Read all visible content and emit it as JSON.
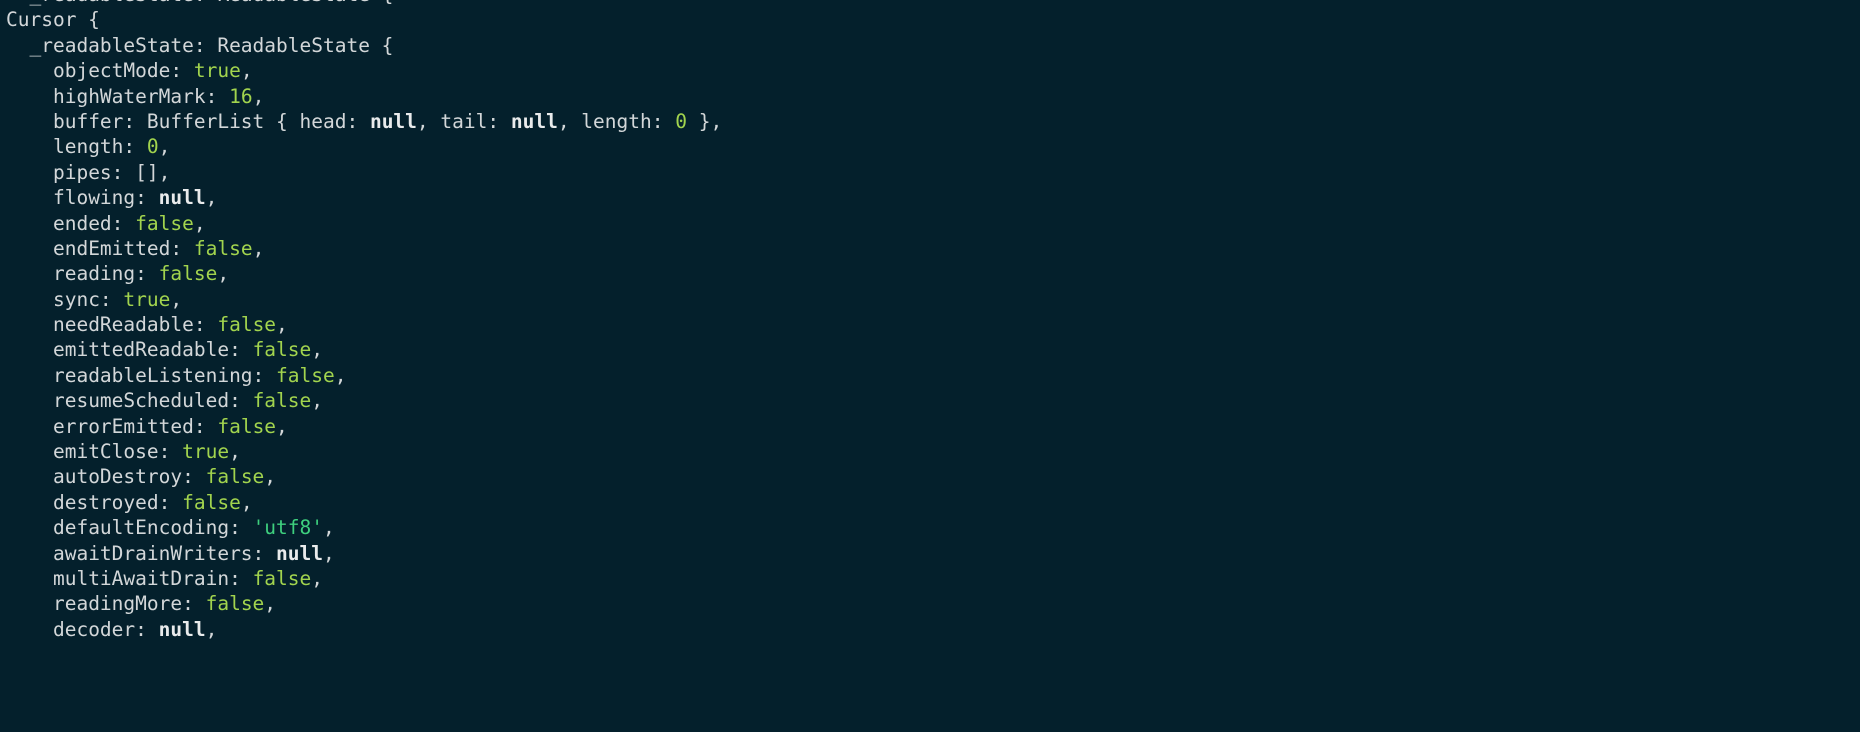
{
  "terminal": {
    "title": "node object inspect output",
    "background_color": "#04202c",
    "font_size_px": 19.5,
    "line_height_px": 25.4,
    "colors": {
      "plain": "#d3d7d9",
      "boolean": "#a2d44e",
      "number": "#a2d44e",
      "null": "#e9ebec",
      "string": "#3ed07e"
    }
  },
  "clipped_top_line": {
    "indent": 0,
    "tokens": [
      {
        "t": "  _readableState: ReadableState {",
        "c": "pl"
      }
    ]
  },
  "lines": [
    {
      "indent": 0,
      "tokens": [
        {
          "t": "Cursor {",
          "c": "pl"
        }
      ]
    },
    {
      "indent": 2,
      "tokens": [
        {
          "t": "_readableState: ReadableState {",
          "c": "pl"
        }
      ]
    },
    {
      "indent": 4,
      "tokens": [
        {
          "t": "objectMode: ",
          "c": "pl"
        },
        {
          "t": "true",
          "c": "bl"
        },
        {
          "t": ",",
          "c": "pl"
        }
      ]
    },
    {
      "indent": 4,
      "tokens": [
        {
          "t": "highWaterMark: ",
          "c": "pl"
        },
        {
          "t": "16",
          "c": "num"
        },
        {
          "t": ",",
          "c": "pl"
        }
      ]
    },
    {
      "indent": 4,
      "tokens": [
        {
          "t": "buffer: BufferList { head: ",
          "c": "pl"
        },
        {
          "t": "null",
          "c": "nul"
        },
        {
          "t": ", tail: ",
          "c": "pl"
        },
        {
          "t": "null",
          "c": "nul"
        },
        {
          "t": ", length: ",
          "c": "pl"
        },
        {
          "t": "0",
          "c": "num"
        },
        {
          "t": " },",
          "c": "pl"
        }
      ]
    },
    {
      "indent": 4,
      "tokens": [
        {
          "t": "length: ",
          "c": "pl"
        },
        {
          "t": "0",
          "c": "num"
        },
        {
          "t": ",",
          "c": "pl"
        }
      ]
    },
    {
      "indent": 4,
      "tokens": [
        {
          "t": "pipes: [],",
          "c": "pl"
        }
      ]
    },
    {
      "indent": 4,
      "tokens": [
        {
          "t": "flowing: ",
          "c": "pl"
        },
        {
          "t": "null",
          "c": "nul"
        },
        {
          "t": ",",
          "c": "pl"
        }
      ]
    },
    {
      "indent": 4,
      "tokens": [
        {
          "t": "ended: ",
          "c": "pl"
        },
        {
          "t": "false",
          "c": "bl"
        },
        {
          "t": ",",
          "c": "pl"
        }
      ]
    },
    {
      "indent": 4,
      "tokens": [
        {
          "t": "endEmitted: ",
          "c": "pl"
        },
        {
          "t": "false",
          "c": "bl"
        },
        {
          "t": ",",
          "c": "pl"
        }
      ]
    },
    {
      "indent": 4,
      "tokens": [
        {
          "t": "reading: ",
          "c": "pl"
        },
        {
          "t": "false",
          "c": "bl"
        },
        {
          "t": ",",
          "c": "pl"
        }
      ]
    },
    {
      "indent": 4,
      "tokens": [
        {
          "t": "sync: ",
          "c": "pl"
        },
        {
          "t": "true",
          "c": "bl"
        },
        {
          "t": ",",
          "c": "pl"
        }
      ]
    },
    {
      "indent": 4,
      "tokens": [
        {
          "t": "needReadable: ",
          "c": "pl"
        },
        {
          "t": "false",
          "c": "bl"
        },
        {
          "t": ",",
          "c": "pl"
        }
      ]
    },
    {
      "indent": 4,
      "tokens": [
        {
          "t": "emittedReadable: ",
          "c": "pl"
        },
        {
          "t": "false",
          "c": "bl"
        },
        {
          "t": ",",
          "c": "pl"
        }
      ]
    },
    {
      "indent": 4,
      "tokens": [
        {
          "t": "readableListening: ",
          "c": "pl"
        },
        {
          "t": "false",
          "c": "bl"
        },
        {
          "t": ",",
          "c": "pl"
        }
      ]
    },
    {
      "indent": 4,
      "tokens": [
        {
          "t": "resumeScheduled: ",
          "c": "pl"
        },
        {
          "t": "false",
          "c": "bl"
        },
        {
          "t": ",",
          "c": "pl"
        }
      ]
    },
    {
      "indent": 4,
      "tokens": [
        {
          "t": "errorEmitted: ",
          "c": "pl"
        },
        {
          "t": "false",
          "c": "bl"
        },
        {
          "t": ",",
          "c": "pl"
        }
      ]
    },
    {
      "indent": 4,
      "tokens": [
        {
          "t": "emitClose: ",
          "c": "pl"
        },
        {
          "t": "true",
          "c": "bl"
        },
        {
          "t": ",",
          "c": "pl"
        }
      ]
    },
    {
      "indent": 4,
      "tokens": [
        {
          "t": "autoDestroy: ",
          "c": "pl"
        },
        {
          "t": "false",
          "c": "bl"
        },
        {
          "t": ",",
          "c": "pl"
        }
      ]
    },
    {
      "indent": 4,
      "tokens": [
        {
          "t": "destroyed: ",
          "c": "pl"
        },
        {
          "t": "false",
          "c": "bl"
        },
        {
          "t": ",",
          "c": "pl"
        }
      ]
    },
    {
      "indent": 4,
      "tokens": [
        {
          "t": "defaultEncoding: ",
          "c": "pl"
        },
        {
          "t": "'utf8'",
          "c": "str"
        },
        {
          "t": ",",
          "c": "pl"
        }
      ]
    },
    {
      "indent": 4,
      "tokens": [
        {
          "t": "awaitDrainWriters: ",
          "c": "pl"
        },
        {
          "t": "null",
          "c": "nul"
        },
        {
          "t": ",",
          "c": "pl"
        }
      ]
    },
    {
      "indent": 4,
      "tokens": [
        {
          "t": "multiAwaitDrain: ",
          "c": "pl"
        },
        {
          "t": "false",
          "c": "bl"
        },
        {
          "t": ",",
          "c": "pl"
        }
      ]
    },
    {
      "indent": 4,
      "tokens": [
        {
          "t": "readingMore: ",
          "c": "pl"
        },
        {
          "t": "false",
          "c": "bl"
        },
        {
          "t": ",",
          "c": "pl"
        }
      ]
    },
    {
      "indent": 4,
      "tokens": [
        {
          "t": "decoder: ",
          "c": "pl"
        },
        {
          "t": "null",
          "c": "nul"
        },
        {
          "t": ",",
          "c": "pl"
        }
      ]
    }
  ]
}
